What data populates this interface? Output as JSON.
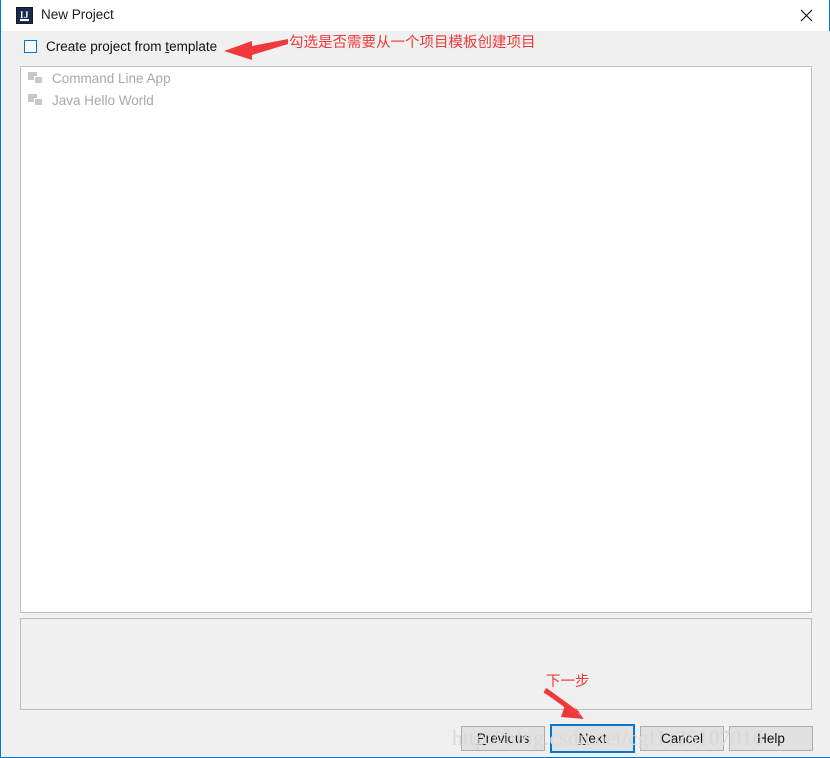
{
  "window": {
    "title": "New Project",
    "app_icon_name": "intellij-idea-icon",
    "app_icon_letters": "IJ",
    "close_icon_name": "close-icon",
    "border_color": "#0078d7"
  },
  "options": {
    "create_from_template": {
      "label_before": "Create project from ",
      "label_mnemonic": "t",
      "label_after": "emplate",
      "checked": false
    }
  },
  "template_list": {
    "items": [
      {
        "label": "Command Line App",
        "icon": "module-icon",
        "enabled": false
      },
      {
        "label": "Java Hello World",
        "icon": "module-icon",
        "enabled": false
      }
    ]
  },
  "description_panel": {
    "text": ""
  },
  "buttons": {
    "previous": {
      "mnemonic": "P",
      "rest": "revious",
      "focused": false
    },
    "next": {
      "mnemonic": "N",
      "rest": "ext",
      "focused": true
    },
    "cancel": {
      "mnemonic": "",
      "rest": "Cancel",
      "focused": false
    },
    "help": {
      "mnemonic": "",
      "rest": "Help",
      "focused": false
    }
  },
  "annotations": {
    "checkbox_note": "勾选是否需要从一个项目模板创建项目",
    "next_note": "下一步",
    "color": "#f0393c"
  },
  "watermark": {
    "text": "http://blog.csdn.net/cgl1125107016"
  }
}
